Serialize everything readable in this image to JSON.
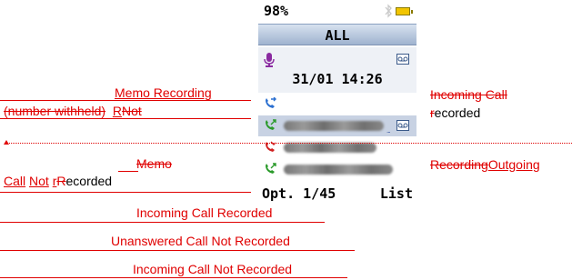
{
  "phone": {
    "battery_percent": "98%",
    "title": "ALL",
    "memo_datetime": "31/01 14:26",
    "page_info": "Opt. 1/45",
    "list_label": "List",
    "calls": [
      {
        "type": "incoming-call",
        "color": "#2a6fd0",
        "number": ""
      },
      {
        "type": "outgoing-call",
        "color": "#2a9a2a",
        "number": "blurred",
        "selected": true
      },
      {
        "type": "missed-call",
        "color": "#d02020",
        "number": "blurred"
      },
      {
        "type": "outgoing-call",
        "color": "#2a9a2a",
        "number": "blurred"
      }
    ]
  },
  "annotations": {
    "memo_recording": "Memo Recording",
    "number_withheld": "(number withheld)",
    "r_ins": "R",
    "not_del": "Not",
    "incoming_call_del": "Incoming Call",
    "r_del": "r",
    "ecorded": "ecorded",
    "memo_del": "Memo",
    "recording_del": "Recording",
    "outgoing_ins": "Outgoing",
    "call_ins": "Call",
    "not_ins": "Not",
    "r_ins2": "r",
    "r_del2": "R",
    "ecorded2": "ecorded",
    "legend_1": "Incoming Call   Recorded",
    "legend_2": "Unanswered Call   Not Recorded",
    "legend_3": "Incoming Call   Not Recorded"
  },
  "colors": {
    "markup": "#e00000",
    "title_bar": "#b7c6dc",
    "selected_row": "#c8d2e3"
  }
}
